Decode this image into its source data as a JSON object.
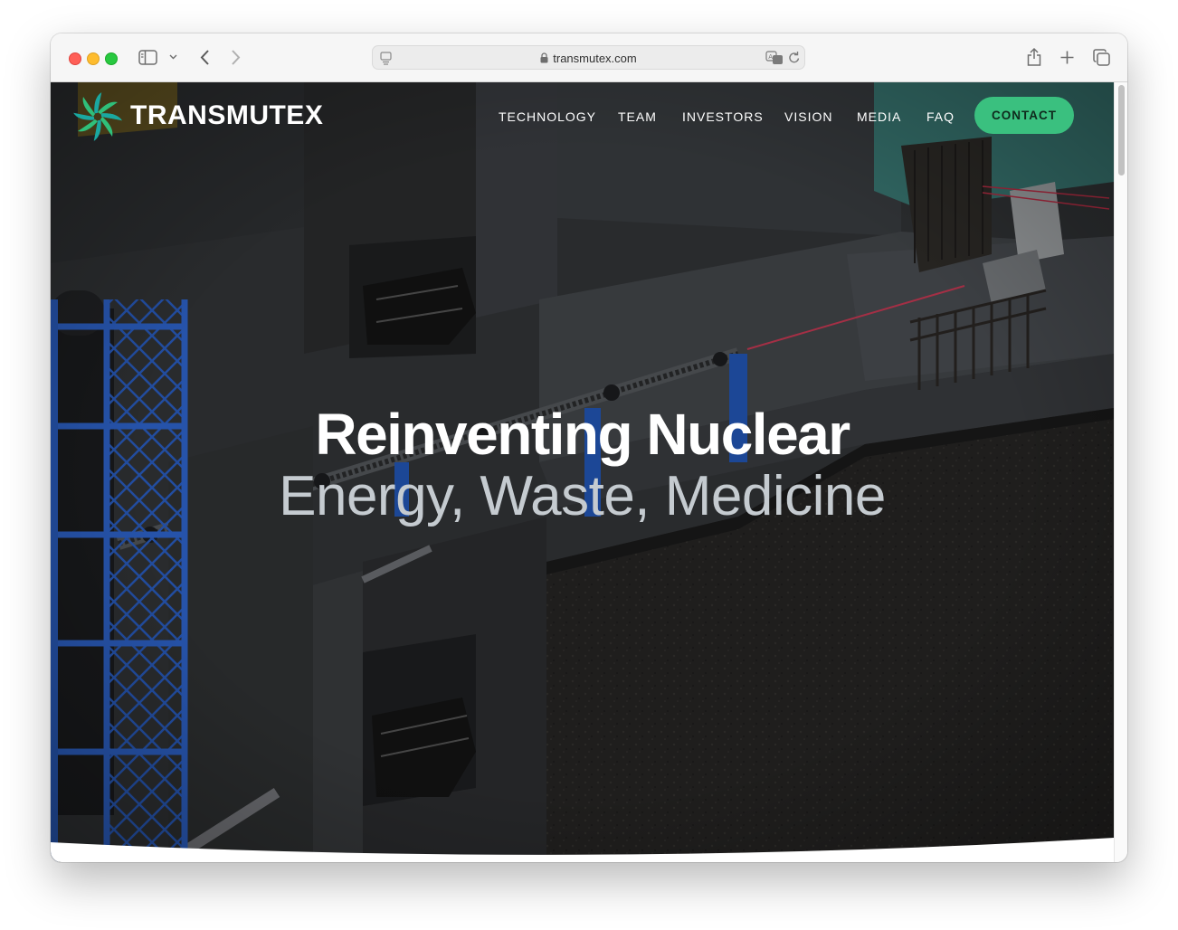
{
  "browser": {
    "url": "transmutex.com"
  },
  "site": {
    "brand": "TRANSMUTEX",
    "nav": {
      "items": [
        "TECHNOLOGY",
        "TEAM",
        "INVESTORS",
        "VISION",
        "MEDIA",
        "FAQ"
      ],
      "cta": "CONTACT"
    },
    "hero": {
      "title": "Reinventing Nuclear",
      "subtitle": "Energy, Waste, Medicine"
    }
  },
  "colors": {
    "accent": "#3ac07f",
    "logo_green": "#2fbf7a",
    "logo_teal": "#1aa8a0",
    "hero_subtitle": "#c5cbd0",
    "structure_blue": "#2357b8"
  },
  "icons": [
    "sidebar-icon",
    "chevron-down-icon",
    "back-icon",
    "forward-icon",
    "page-icon",
    "lock-icon",
    "translate-icon",
    "reload-icon",
    "share-icon",
    "plus-icon",
    "tabs-icon"
  ]
}
